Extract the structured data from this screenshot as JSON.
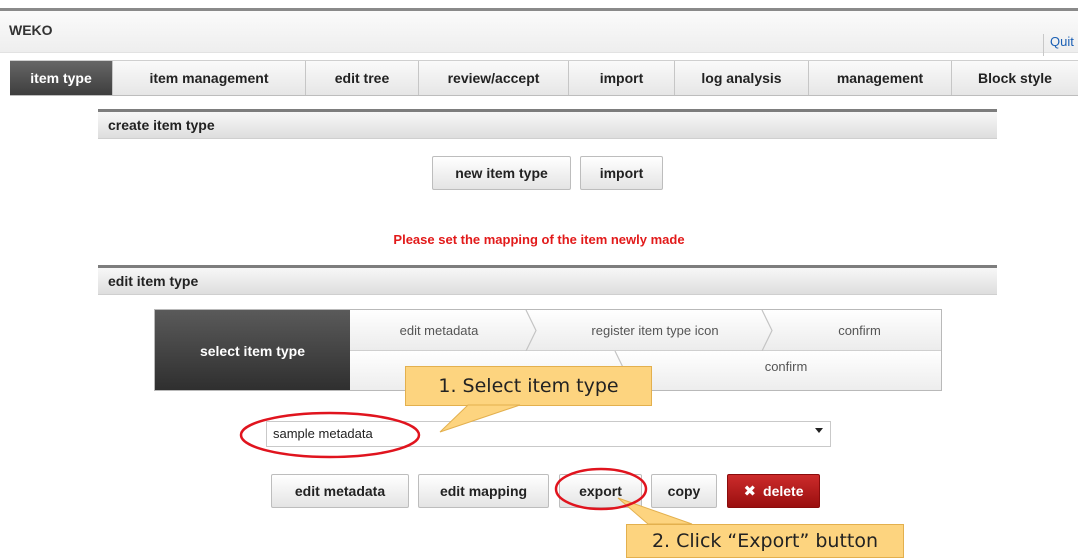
{
  "app": {
    "name": "WEKO",
    "quit_label": "Quit"
  },
  "tabs": [
    {
      "label": "item type",
      "active": true
    },
    {
      "label": "item management",
      "active": false
    },
    {
      "label": "edit tree",
      "active": false
    },
    {
      "label": "review/accept",
      "active": false
    },
    {
      "label": "import",
      "active": false
    },
    {
      "label": "log analysis",
      "active": false
    },
    {
      "label": "management",
      "active": false
    },
    {
      "label": "Block style",
      "active": false
    }
  ],
  "create_section": {
    "title": "create item type",
    "new_button": "new item type",
    "import_button": "import"
  },
  "notice": "Please set the mapping of the item newly made",
  "edit_section": {
    "title": "edit item type",
    "steps": {
      "active": "select item type",
      "row1": [
        "edit metadata",
        "register item type icon",
        "confirm"
      ],
      "row2": [
        "confirm"
      ]
    },
    "select_value": "sample metadata",
    "buttons": {
      "edit_metadata": "edit metadata",
      "edit_mapping": "edit mapping",
      "export": "export",
      "copy": "copy",
      "delete": "delete"
    }
  },
  "annotations": {
    "callout1": "1. Select item type",
    "callout2": "2. Click “Export” button"
  },
  "colors": {
    "notice_red": "#e21a1a",
    "delete_red": "#b51818",
    "callout_fill": "#fdd47f",
    "highlight_ring": "#e0141e",
    "active_tab": "#4a4a4a"
  },
  "icons": {
    "delete": "x-icon",
    "dropdown": "chevron-down-icon"
  }
}
